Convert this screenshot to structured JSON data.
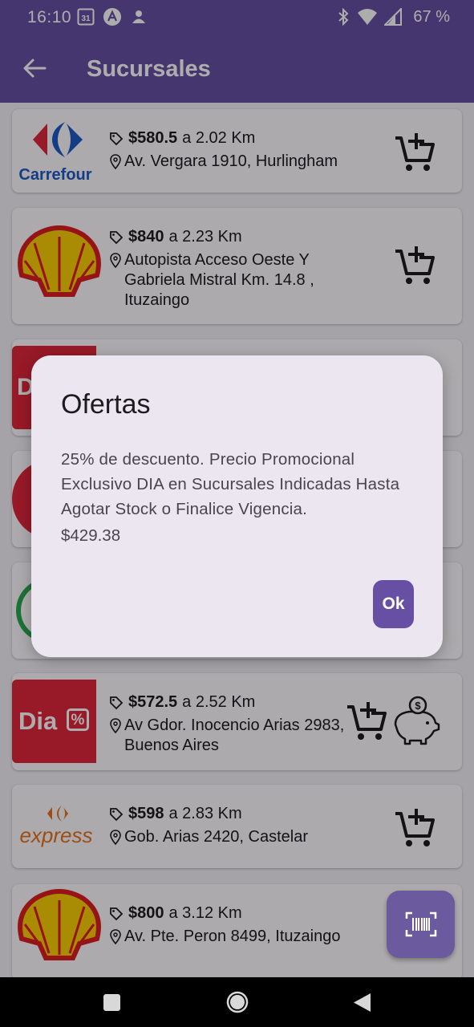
{
  "status_bar": {
    "time": "16:10",
    "calendar_day": "31",
    "battery": "67 %"
  },
  "toolbar": {
    "title": "Sucursales"
  },
  "stores": [
    {
      "logo": "carrefour-logo",
      "logo_text": "Carrefour",
      "price": "$580.5",
      "distance": "a 2.02 Km",
      "address": "Av. Vergara 1910, Hurlingham"
    },
    {
      "logo": "shell-logo",
      "price": "$840",
      "distance": "a 2.23 Km",
      "address": "Autopista Acceso Oeste Y Gabriela Mistral Km. 14.8 , Ituzaingo"
    },
    {
      "logo": "dia-logo",
      "partially_hidden": true
    },
    {
      "logo": "dia-logo",
      "partially_hidden": true
    },
    {
      "logo": "jumbo-logo",
      "partially_hidden": true
    },
    {
      "logo": "dia-logo",
      "logo_text": "Dia",
      "price": "$572.5",
      "distance": "a 2.52 Km",
      "address": "Av Gdor. Inocencio Arias 2983, Buenos Aires",
      "has_offer": true
    },
    {
      "logo": "carrefour-express-logo",
      "logo_text": "express",
      "price": "$598",
      "distance": "a 2.83 Km",
      "address": "Gob. Arias 2420, Castelar"
    },
    {
      "logo": "shell-logo",
      "price": "$800",
      "distance": "a 3.12 Km",
      "address": "Av. Pte. Peron 8499, Ituzaingo"
    }
  ],
  "dialog": {
    "title": "Ofertas",
    "body": "25% de descuento. Precio Promocional Exclusivo DIA en Sucursales Indicadas Hasta Agotar Stock o Finalice Vigencia.",
    "price": "$429.38",
    "ok_label": "Ok"
  },
  "colors": {
    "primary": "#6750a4",
    "dialog_bg": "#ece6f0",
    "dia_red": "#e0253a",
    "shell_yellow": "#fbce07",
    "shell_red": "#dd1d21",
    "carrefour_blue": "#1e5bc6"
  }
}
